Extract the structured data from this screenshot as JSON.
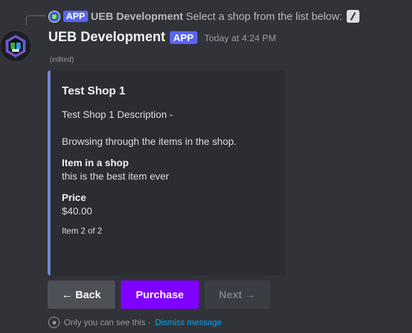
{
  "reply": {
    "app_tag": "APP",
    "author": "UEB Development",
    "text": "Select a shop from the list below:"
  },
  "message": {
    "author": "UEB Development",
    "app_tag": "APP",
    "timestamp": "Today at 4:24 PM",
    "edited": "(edited)"
  },
  "embed": {
    "accent_color": "#7289da",
    "title": "Test Shop 1",
    "description": "Test Shop 1 Description -\n\nBrowsing through the items in the shop.",
    "fields": [
      {
        "name": "Item in a shop",
        "value": "this is the best item ever"
      },
      {
        "name": "Price",
        "value": "$40.00"
      }
    ],
    "footer": "Item 2 of 2"
  },
  "buttons": {
    "back": "← Back",
    "purchase": "Purchase",
    "next": "Next →"
  },
  "ephemeral": {
    "text": "Only you can see this ·",
    "dismiss": "Dismiss message"
  },
  "colors": {
    "background": "#313338",
    "embed_bg": "#2b2d31",
    "app_tag": "#5865f2",
    "purchase_button": "#7f00ff",
    "link": "#00a8fc"
  },
  "icons": {
    "reply_avatar": "bot-avatar-icon",
    "slash": "slash-command-icon",
    "eye": "eye-icon"
  }
}
